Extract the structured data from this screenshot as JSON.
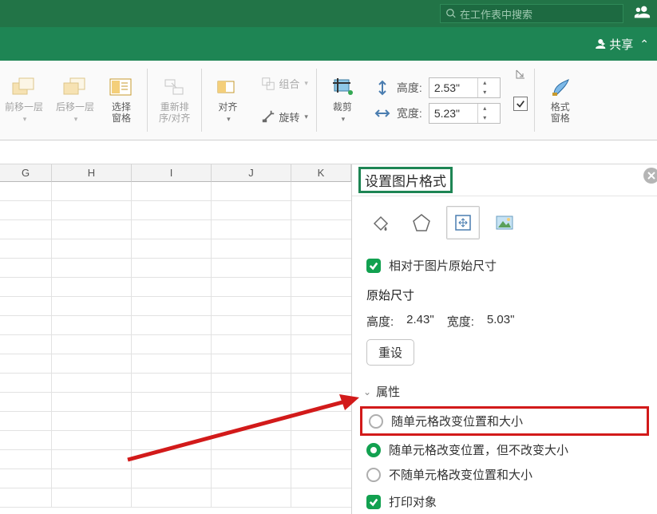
{
  "topbar": {
    "search_placeholder": "在工作表中搜索"
  },
  "sharebar": {
    "share_label": "共享"
  },
  "ribbon": {
    "back_layer": "后移一层",
    "fwd_layer": "前移一层",
    "select_pane": "选择\n窗格",
    "realign": "重新排\n序/对齐",
    "align": "对齐",
    "group": "组合",
    "rotate": "旋转",
    "crop": "裁剪",
    "height_label": "高度:",
    "width_label": "宽度:",
    "height_value": "2.53\"",
    "width_value": "5.23\"",
    "format_pane": "格式\n窗格"
  },
  "columns": [
    "G",
    "H",
    "I",
    "J",
    "K"
  ],
  "panel": {
    "title": "设置图片格式",
    "relative_label": "相对于图片原始尺寸",
    "orig_header": "原始尺寸",
    "orig_height_label": "高度:",
    "orig_height_value": "2.43\"",
    "orig_width_label": "宽度:",
    "orig_width_value": "5.03\"",
    "reset_label": "重设",
    "props_header": "属性",
    "radio1": "随单元格改变位置和大小",
    "radio2": "随单元格改变位置，但不改变大小",
    "radio3": "不随单元格改变位置和大小",
    "print_label": "打印对象"
  }
}
